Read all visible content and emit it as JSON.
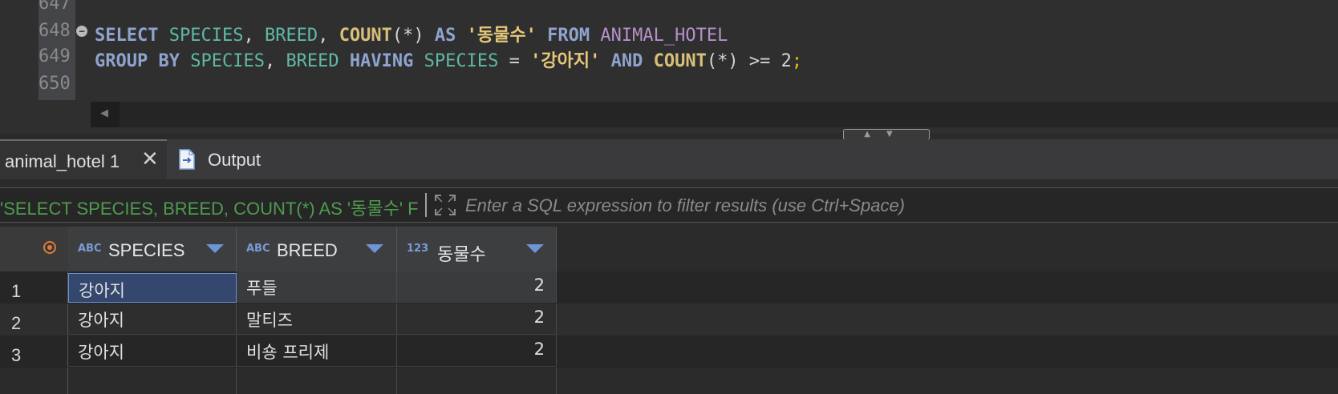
{
  "editor": {
    "line_numbers": [
      "647",
      "648",
      "649",
      "650"
    ],
    "fold_marker": "⊖",
    "line_648": {
      "select": "SELECT",
      "species": "SPECIES",
      "comma1": ", ",
      "breed": "BREED",
      "comma2": ", ",
      "count": "COUNT",
      "count_args": "(*)",
      "as": "AS",
      "alias": "'동물수'",
      "from": "FROM",
      "table": "ANIMAL_HOTEL"
    },
    "line_649": {
      "group_by": "GROUP BY",
      "species": "SPECIES",
      "comma1": ", ",
      "breed": "BREED",
      "having": "HAVING",
      "species2": "SPECIES",
      "eq": " = ",
      "value": "'강아지'",
      "and": "AND",
      "count": "COUNT",
      "count_args": "(*)",
      "gte": " >= ",
      "num": "2",
      "semi": ";"
    },
    "scroll_left_arrow": "◀",
    "splitter_arrows": "▲▼"
  },
  "tabs": {
    "results_tab": "animal_hotel 1",
    "close_glyph": "✕",
    "output_tab": "Output"
  },
  "filter": {
    "query_text": "'SELECT SPECIES, BREED, COUNT(*) AS '동물수' F",
    "placeholder": "Enter a SQL expression to filter results (use Ctrl+Space)"
  },
  "grid": {
    "columns": [
      {
        "type": "ABC",
        "label": "SPECIES"
      },
      {
        "type": "ABC",
        "label": "BREED"
      },
      {
        "type": "123",
        "label": "동물수"
      }
    ],
    "rows": [
      {
        "num": "1",
        "species": "강아지",
        "breed": "푸들",
        "count": "2"
      },
      {
        "num": "2",
        "species": "강아지",
        "breed": "말티즈",
        "count": "2"
      },
      {
        "num": "3",
        "species": "강아지",
        "breed": "비숑 프리제",
        "count": "2"
      }
    ]
  },
  "colors": {
    "keyword": "#8fa3cf",
    "identifier": "#5fb9a6",
    "string": "#e6c77a",
    "table": "#b690c9",
    "selection": "#34476e",
    "sort_arrow": "#6d93d8"
  }
}
